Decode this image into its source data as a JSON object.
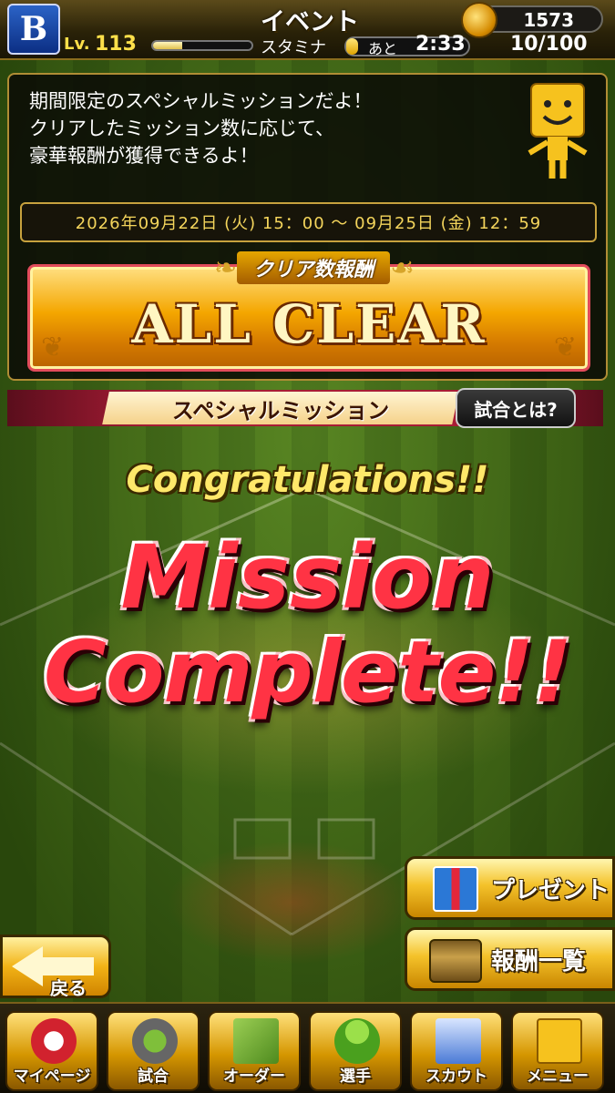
{
  "header": {
    "title": "イベント",
    "team_logo": "B",
    "coins": "1573",
    "level_label": "Lv.",
    "level": "113",
    "stamina_label": "スタミナ",
    "recover_label": "あと",
    "recover_time": "2:33",
    "stamina": "10/100",
    "stamina_fraction": 0.1,
    "exp_fraction": 0.3
  },
  "info": {
    "lines": [
      "期間限定のスペシャルミッションだよ！",
      "クリアしたミッション数に応じて、",
      "豪華報酬が獲得できるよ！"
    ],
    "period": "2026年09月22日 (火) 15：00 ～ 09月25日 (金) 12：59",
    "reward_label": "クリア数報酬",
    "reward_status": "ALL CLEAR"
  },
  "mission_strip": {
    "label": "スペシャルミッション",
    "help_button": "試合とは?"
  },
  "result": {
    "congrats": "Congratulations!!",
    "line1": "Mission",
    "line2": "Complete!!"
  },
  "side_buttons": {
    "present": "プレゼント",
    "reward_list": "報酬一覧"
  },
  "back_button": "戻る",
  "bottom_nav": [
    {
      "label": "マイページ",
      "icon": "my-page-icon"
    },
    {
      "label": "試合",
      "icon": "stadium-icon"
    },
    {
      "label": "オーダー",
      "icon": "lineup-field-icon"
    },
    {
      "label": "選手",
      "icon": "player-icon"
    },
    {
      "label": "スカウト",
      "icon": "scout-card-icon"
    },
    {
      "label": "メニュー",
      "icon": "menu-mascot-icon"
    }
  ],
  "colors": {
    "accent_gold": "#f4c22a",
    "mission_red": "#ff3344",
    "strip_red": "#a81c35",
    "field_green": "#4a7b16"
  }
}
